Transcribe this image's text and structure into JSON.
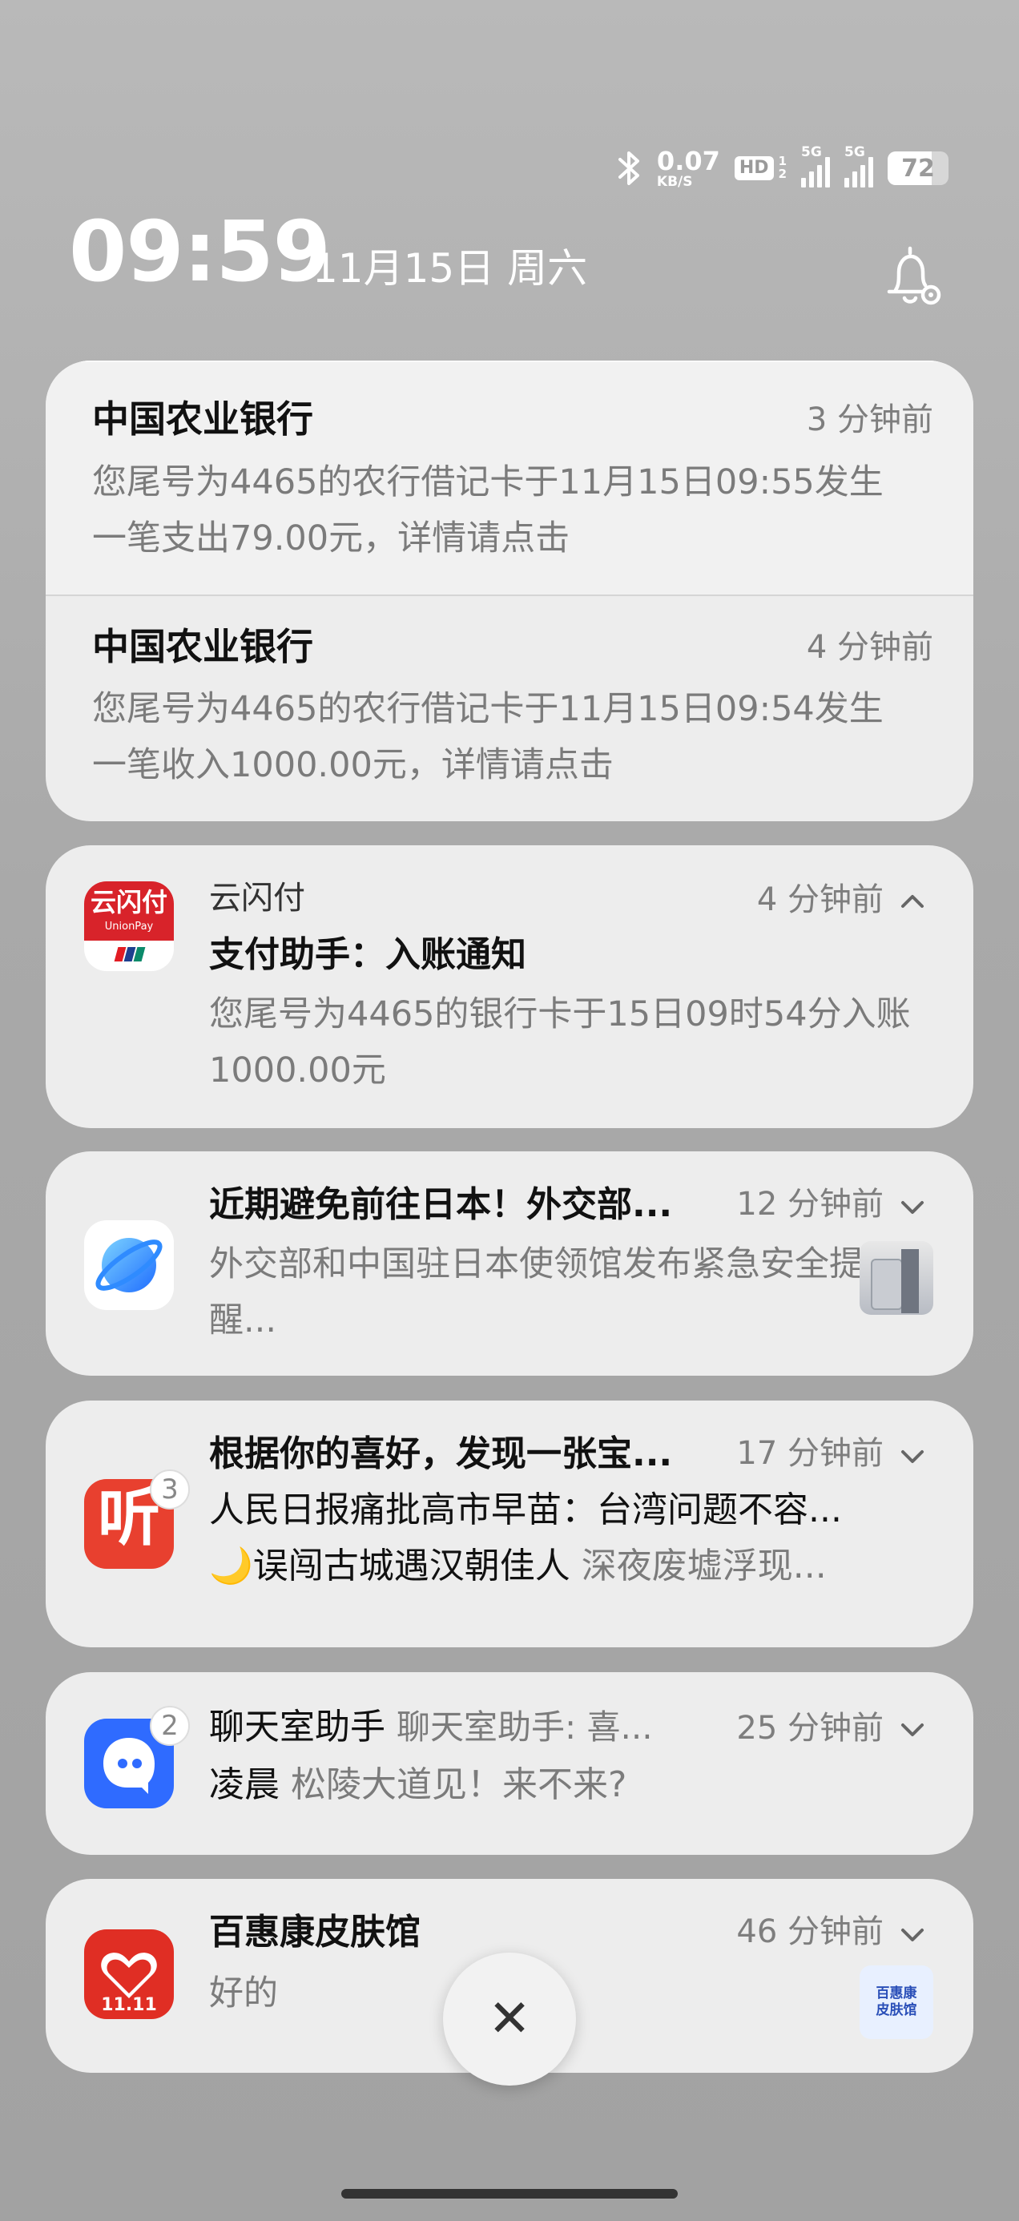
{
  "status_bar": {
    "net_speed": "0.07",
    "net_unit": "KB/S",
    "hd_label": "HD",
    "hd_sim": "1\n2",
    "sim1": "5G",
    "sim2": "5G",
    "battery": "72",
    "battery_level_pct": 72
  },
  "header": {
    "time": "09:59",
    "date": "11月15日 周六"
  },
  "notifications": {
    "abc_1": {
      "app": "中国农业银行",
      "time": "3 分钟前",
      "message": "您尾号为4465的农行借记卡于11月15日09:55发生一笔支出79.00元，详情请点击"
    },
    "abc_2": {
      "app": "中国农业银行",
      "time": "4 分钟前",
      "message": "您尾号为4465的农行借记卡于11月15日09:54发生一笔收入1000.00元，详情请点击"
    },
    "unionpay": {
      "app": "云闪付",
      "time": "4 分钟前",
      "title": "支付助手：入账通知",
      "body": "您尾号为4465的银行卡于15日09时54分入账1000.00元",
      "icon_text": "云闪付",
      "icon_sub": "UnionPay"
    },
    "news": {
      "title": "近期避免前往日本！外交部...",
      "time": "12 分钟前",
      "body": "外交部和中国驻日本使领馆发布紧急安全提醒..."
    },
    "ting": {
      "title": "根据你的喜好，发现一张宝...",
      "time": "17 分钟前",
      "line2": "人民日报痛批高市早苗：台湾问题不容...",
      "line3_dark": "🌙误闯古城遇汉朝佳人",
      "line3_gray": "深夜废墟浮现...",
      "badge": "3",
      "icon_text": "听"
    },
    "chat": {
      "title": "聊天室助手",
      "title_gray": "聊天室助手: 喜...",
      "time": "25 分钟前",
      "line_dark": "凌晨",
      "line_gray": "松陵大道见！来不来?",
      "badge": "2"
    },
    "pdd": {
      "title": "百惠康皮肤馆",
      "time": "46 分钟前",
      "body": "好的",
      "icon_text": "11.11",
      "thumb_text": "百惠康\n皮肤馆"
    }
  },
  "controls": {
    "close_symbol": "✕"
  },
  "colors": {
    "unionpay_red": "#d8232a",
    "ting_red": "#e8402f",
    "chat_blue": "#2f6bff",
    "pdd_red": "#e02e24"
  }
}
